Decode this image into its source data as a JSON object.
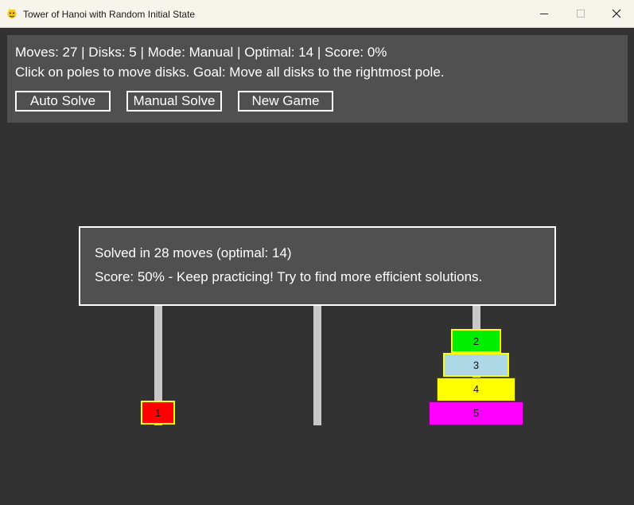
{
  "window": {
    "title": "Tower of Hanoi with Random Initial State",
    "app_icon": "python-pygame-icon",
    "controls": [
      "minimize-icon",
      "maximize-icon",
      "close-icon"
    ]
  },
  "info": {
    "stats": "Moves: 27 | Disks: 5 | Mode: Manual | Optimal: 14 | Score: 0%",
    "instructions": "Click on poles to move disks. Goal: Move all disks to the rightmost pole."
  },
  "buttons": {
    "auto_solve": "Auto Solve",
    "manual_solve": "Manual Solve",
    "new_game": "New Game"
  },
  "board": {
    "poles": [
      {
        "disks": [
          "1"
        ]
      },
      {
        "disks": []
      },
      {
        "disks": [
          "2",
          "3",
          "4",
          "5"
        ]
      }
    ],
    "disk_colors": {
      "1": "#ff0000",
      "2": "#00ee00",
      "3": "#add8e6",
      "4": "#ffff00",
      "5": "#ff00ff"
    },
    "highlight_color": "#ffff00"
  },
  "dialog": {
    "line1": "Solved in 28 moves (optimal: 14)",
    "line2": "Score: 50% - Keep practicing! Try to find more efficient solutions."
  },
  "colors": {
    "background": "#323232",
    "panel": "#505050",
    "pole": "#c8c8c8"
  }
}
